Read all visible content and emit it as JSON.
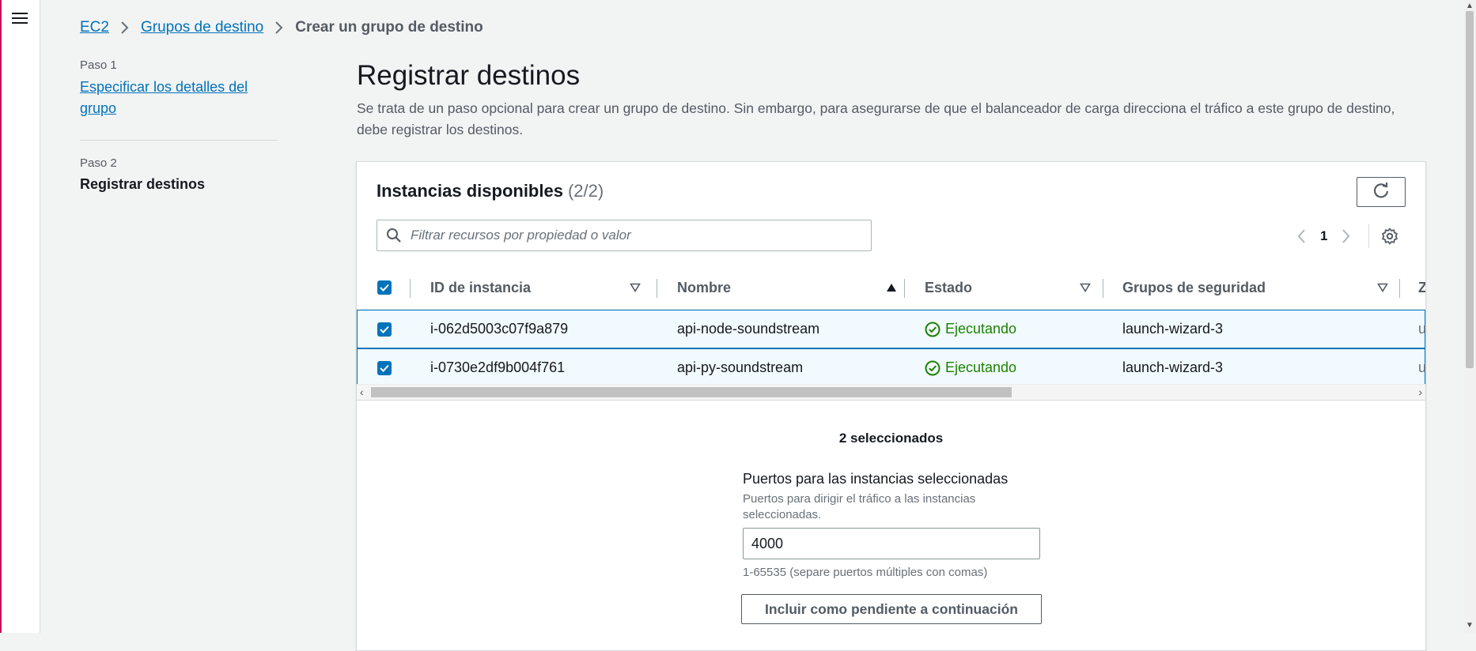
{
  "breadcrumb": {
    "items": [
      "EC2",
      "Grupos de destino"
    ],
    "current": "Crear un grupo de destino"
  },
  "steps": {
    "step1_label": "Paso 1",
    "step1_link": "Especificar los detalles del grupo",
    "step2_label": "Paso 2",
    "step2_current": "Registrar destinos"
  },
  "main": {
    "title": "Registrar destinos",
    "description": "Se trata de un paso opcional para crear un grupo de destino. Sin embargo, para asegurarse de que el balanceador de carga direcciona el tráfico a este grupo de destino, debe registrar los destinos."
  },
  "panel": {
    "title": "Instancias disponibles",
    "count": "(2/2)",
    "search_placeholder": "Filtrar recursos por propiedad o valor",
    "page_number": "1"
  },
  "table": {
    "columns": {
      "instance_id": "ID de instancia",
      "name": "Nombre",
      "state": "Estado",
      "security_groups": "Grupos de seguridad",
      "partial": "Z"
    },
    "rows": [
      {
        "instance_id": "i-062d5003c07f9a879",
        "name": "api-node-soundstream",
        "state": "Ejecutando",
        "security_group": "launch-wizard-3",
        "partial": "u"
      },
      {
        "instance_id": "i-0730e2df9b004f761",
        "name": "api-py-soundstream",
        "state": "Ejecutando",
        "security_group": "launch-wizard-3",
        "partial": "u"
      }
    ]
  },
  "selection": {
    "count_label": "2 seleccionados"
  },
  "ports": {
    "label": "Puertos para las instancias seleccionadas",
    "description": "Puertos para dirigir el tráfico a las instancias seleccionadas.",
    "value": "4000",
    "hint": "1-65535 (separe puertos múltiples con comas)",
    "include_button": "Incluir como pendiente a continuación"
  },
  "colors": {
    "link": "#0073bb",
    "success": "#1d8102",
    "selected_row_bg": "#f1faff",
    "accent_left_border": "#c7105a"
  },
  "icons": [
    "menu-icon",
    "chevron-right-icon",
    "refresh-icon",
    "search-icon",
    "chevron-left-icon",
    "settings-gear-icon",
    "sort-caret-icon",
    "status-check-icon",
    "checkbox-checked-icon"
  ]
}
